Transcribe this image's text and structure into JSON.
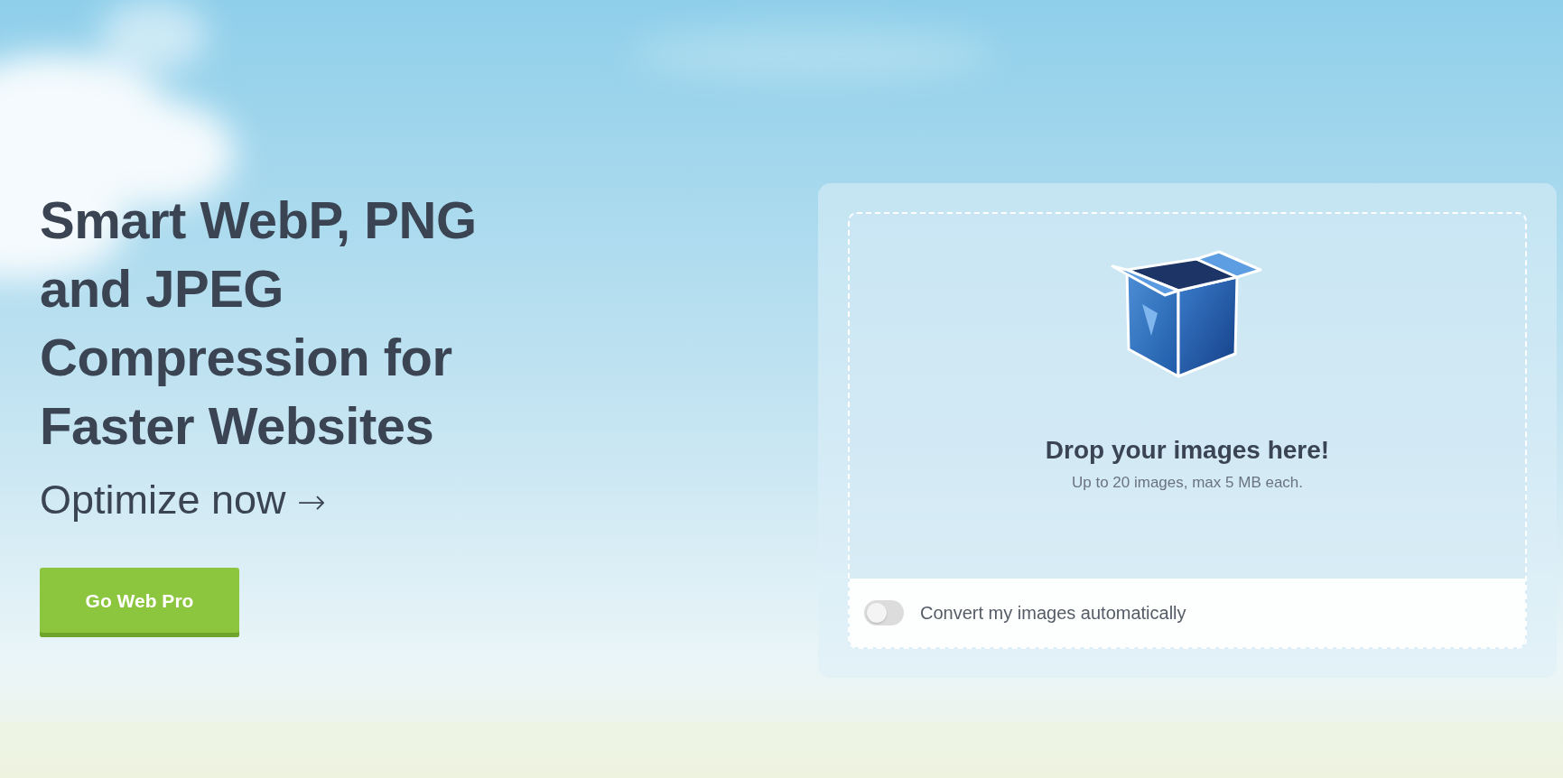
{
  "hero": {
    "heading": "Smart WebP, PNG and JPEG Compression for Faster Websites",
    "link": {
      "label": "Optimize now",
      "arrow": "→"
    },
    "button": "Go Web Pro"
  },
  "uploader": {
    "title": "Drop your images here!",
    "subtitle": "Up to 20 images, max 5 MB each.",
    "toggle": {
      "label": "Convert my images automatically",
      "on": false
    }
  }
}
